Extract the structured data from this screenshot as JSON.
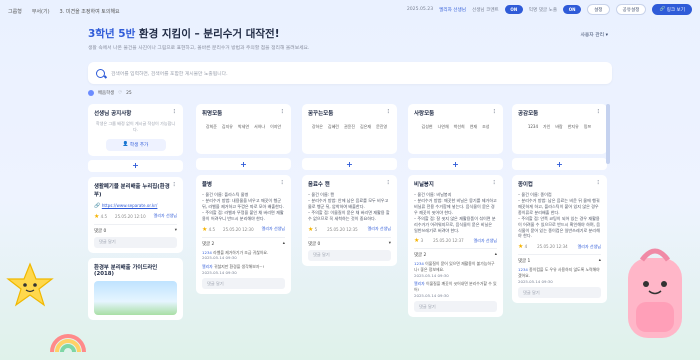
{
  "topbar": {
    "breadcrumb": [
      "그룹형",
      "부서(기)",
      "3. 미견을 조정하여 토의해요"
    ],
    "date": "2025.05.23",
    "teacher": "엘리자 선생님",
    "anon_label": "선생님 코멘트",
    "anon_toggle": "ON",
    "comment_label": "익명 댓글 노출",
    "comment_toggle": "ON",
    "settings": "설정",
    "share": "공유설정",
    "link_view": "링크 보기"
  },
  "header": {
    "class_name": "3학년 5반",
    "title": "환경 지킴이 – 분리수거 대작전!",
    "subtitle": "생활 속에서 나온 물건을 사진이나 그림으로 표현하고, 올바른 분리수거 방법과 주의할 점을 정리해 올려보세요.",
    "viewer_menu": "사용자 관리"
  },
  "search": {
    "placeholder": "검색어를 입력하면, 검색어를 포함한 게시물만 노출됩니다."
  },
  "meta": {
    "author": "배움학생",
    "count": "25"
  },
  "columns": [
    {
      "name": "선생님 공지사항",
      "description": "학생은 그룹 배정 없이 게시글 작성이 가능합니다.",
      "button": "학생 추가",
      "cards": [
        {
          "title": "생활폐기물 분리배출 누리집(환경부)",
          "link": "https://www.separate.or.kr/",
          "rating": "4.5",
          "date": "25.05.20 12:10",
          "author": "엘리자 선생님",
          "comment_label": "댓글 0",
          "comment_placeholder": "댓글 달기"
        },
        {
          "title": "환경부 분리배출 가이드라인(2018)"
        }
      ]
    },
    {
      "name": "휘명모둠",
      "tags": [
        "강희준",
        "김지유",
        "박세연",
        "서하나",
        "이지안"
      ],
      "cards": [
        {
          "title": "물병",
          "body": "– 물건 이름: 플라스틱 물병\n– 분리수거 방법: 내용물을 비우고 깨끗이 헹군 뒤, 라벨을 제거하고 뚜껑은 따로 모아 배출한다.\n– 주의할 점: 라벨과 뚜껑을 붙인 채 버리면 재활용이 어려우니 반드시 분리해야 한다.",
          "rating": "4.5",
          "date": "25.05.20 12:30",
          "author": "엘리자 선생님",
          "comment_label": "댓글 2",
          "replies": [
            {
              "who": "1234",
              "text": "라벨을 제거하기가 조금 귀찮아요.",
              "time": "2025.05.14 09:30"
            },
            {
              "who": "엘리자",
              "text": "귀찮지만 환경을 생각해보자~!",
              "time": "2025.05.14 09:30"
            }
          ],
          "comment_placeholder": "댓글 달기"
        }
      ]
    },
    {
      "name": "꿈꾸는모둠",
      "tags": [
        "강하은",
        "김혜린",
        "권윤진",
        "김은재",
        "문진영"
      ],
      "cards": [
        {
          "title": "음료수 캔",
          "body": "– 물건 이름: 캔\n– 분리수거 방법: 안에 남은 음료를 모두 비우고 물로 헹군 뒤, 압착하여 배출한다.\n– 주의할 점: 이물질이 묻은 채 버리면 재활용 할 수 없으므로 꼭 세척하는 것이 중요하다.",
          "rating": "5",
          "date": "25.05.20 12:35",
          "author": "엘리자 선생님",
          "comment_label": "댓글 0",
          "comment_placeholder": "댓글 달기"
        }
      ]
    },
    {
      "name": "사랑모둠",
      "tags": [
        "김성현",
        "나연채",
        "박선희",
        "연재",
        "조성"
      ],
      "cards": [
        {
          "title": "비닐봉지",
          "body": "– 물건 이름: 비닐봉지\n– 분리수거 방법: 깨끗한 비닐은 뭉기를 제거하고 비닐류 전용 수거함에 넣는다. 음식물이 묻은 경우 깨끗이 씻어야 한다.\n– 주의할 점: 잘 씻지 않은 재활용품이 섞이면 분리수거가 어려워지므로, 음식물이 묻은 비닐은 일반쓰레기로 버려야 한다.",
          "rating": "3",
          "date": "25.05.20 12:37",
          "author": "엘리자 선생님",
          "comment_label": "댓글 2",
          "replies": [
            {
              "who": "1234",
              "text": "이물질이 묻어 있으면 재활용이 불가능하구나! 좋은 정보에요.",
              "time": "2025.05.14 09:30"
            },
            {
              "who": "엘리자",
              "text": "이물질을 깨끗이 씻어내면 분리수거할 수 있어!",
              "time": "2025.05.14 09:30"
            }
          ],
          "comment_placeholder": "댓글 달기"
        }
      ]
    },
    {
      "name": "공감모둠",
      "tags": [
        "1234",
        "가인",
        "바람",
        "한지유",
        "밍쯔"
      ],
      "cards": [
        {
          "title": "종이컵",
          "body": "– 물건 이름: 종이컵\n– 분리수거 방법: 남은 음료는 비운 뒤 물에 헹궈 깨끗하게 하고, 플라스틱이 붙어 있지 않은 경우 종이류로 분리배출 한다.\n– 주의할 점: 안쪽 코팅이 되어 있는 경우 재활용이 어려울 수 있으므로 반드시 확인해야 하며, 음식물이 묻어 있는 종이컵은 일반쓰레기로 분리해야 한다.",
          "rating": "4",
          "date": "25.05.20 12:34",
          "author": "엘리자 선생님",
          "comment_label": "댓글 1",
          "replies": [
            {
              "who": "1234",
              "text": "종이컵을 도 우유 사용하지 않도록 노력해야겠어요.",
              "time": "2025.05.14 09:30"
            }
          ],
          "comment_placeholder": "댓글 달기"
        }
      ]
    }
  ],
  "icons": [
    "search-icon",
    "add-icon",
    "star-icon",
    "more-icon",
    "link-icon",
    "chevron-down-icon"
  ],
  "colors": {
    "accent": "#2f5bd8",
    "star": "#f5b300"
  }
}
